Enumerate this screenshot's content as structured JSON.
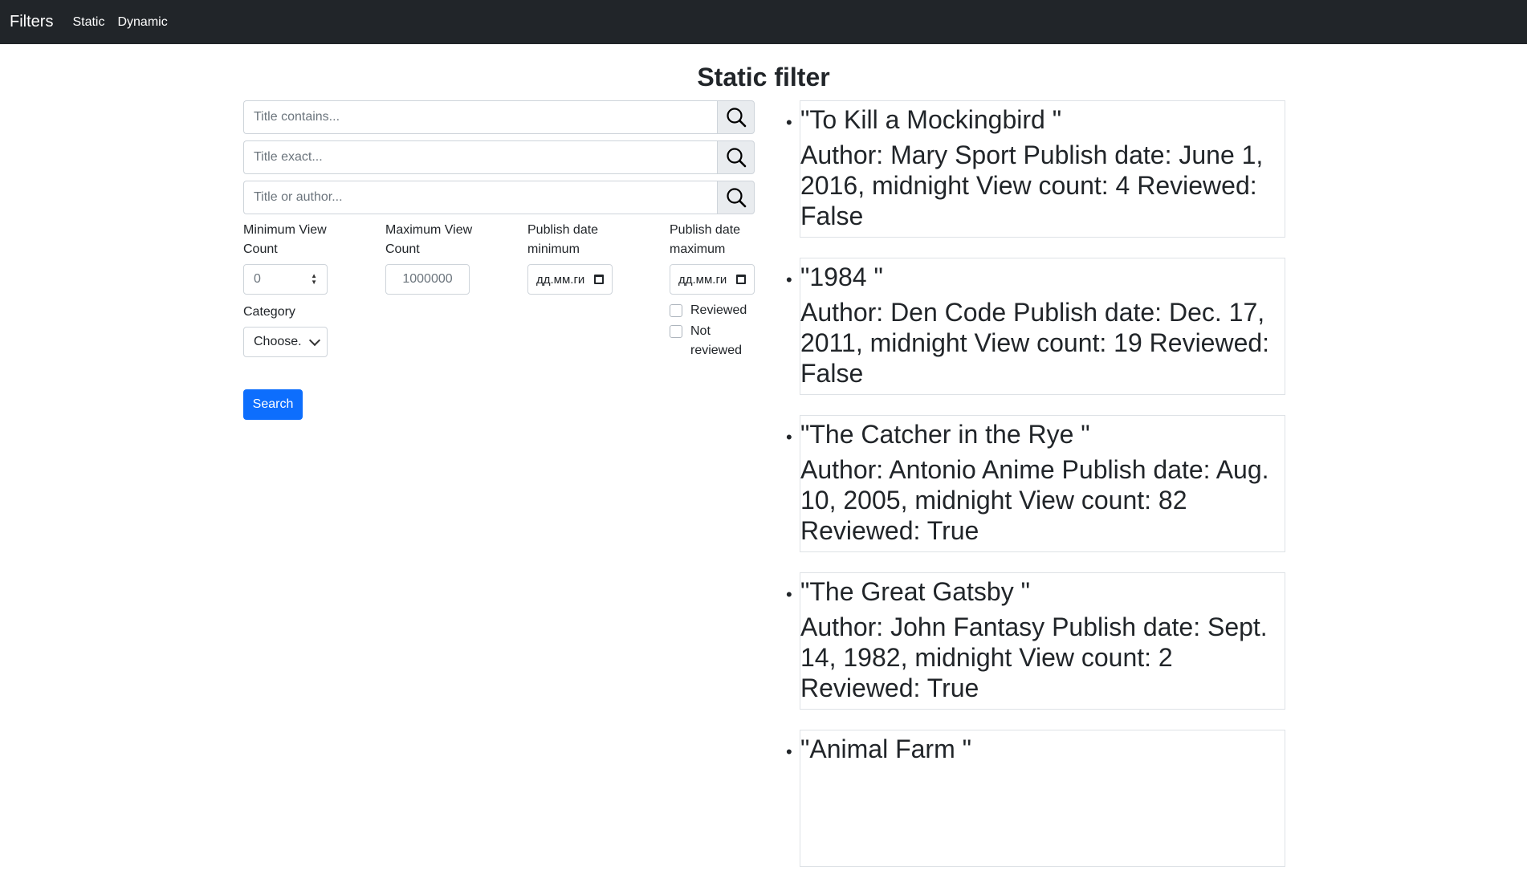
{
  "navbar": {
    "brand": "Filters",
    "links": [
      "Static",
      "Dynamic"
    ]
  },
  "page_title": "Static filter",
  "search_fields": [
    {
      "placeholder": "Title contains..."
    },
    {
      "placeholder": "Title exact..."
    },
    {
      "placeholder": "Title or author..."
    }
  ],
  "filters": {
    "min_view": {
      "label": "Minimum View Count",
      "value": "0"
    },
    "max_view": {
      "label": "Maximum View Count",
      "placeholder": "1000000"
    },
    "date_min": {
      "label": "Publish date minimum",
      "value": "дд.мм.ги"
    },
    "date_max": {
      "label": "Publish date maximum",
      "value": "дд.мм.ги"
    },
    "category": {
      "label": "Category",
      "value": "Choose."
    },
    "reviewed": "Reviewed",
    "not_reviewed": "Not reviewed"
  },
  "search_button": "Search",
  "books": [
    {
      "title": "\"To Kill a Mockingbird \"",
      "meta": "Author: Mary Sport Publish date: June 1, 2016, midnight View count: 4 Reviewed: False"
    },
    {
      "title": "\"1984 \"",
      "meta": "Author: Den Code Publish date: Dec. 17, 2011, midnight View count: 19 Reviewed: False"
    },
    {
      "title": "\"The Catcher in the Rye \"",
      "meta": "Author: Antonio Anime Publish date: Aug. 10, 2005, midnight View count: 82 Reviewed: True"
    },
    {
      "title": "\"The Great Gatsby \"",
      "meta": "Author: John Fantasy Publish date: Sept. 14, 1982, midnight View count: 2 Reviewed: True"
    },
    {
      "title": "\"Animal Farm \"",
      "meta": ""
    }
  ]
}
